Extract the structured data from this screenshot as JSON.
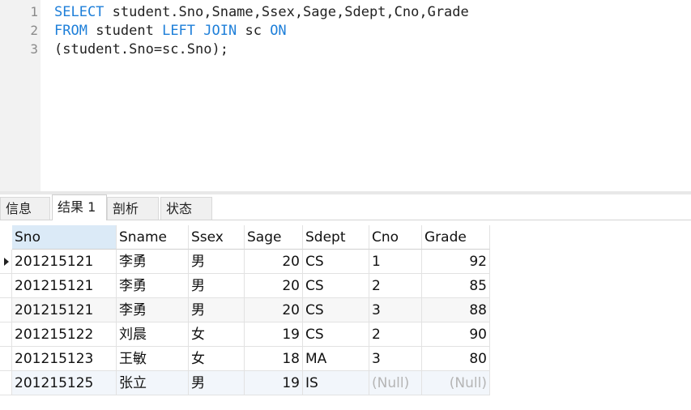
{
  "editor": {
    "lines": [
      {
        "number": "1",
        "tokens": [
          {
            "text": "SELECT",
            "kind": "kw"
          },
          {
            "text": " student.Sno,Sname,Ssex,Sage,Sdept,Cno,Grade",
            "kind": "plain"
          }
        ]
      },
      {
        "number": "2",
        "tokens": [
          {
            "text": "FROM",
            "kind": "kw"
          },
          {
            "text": " student ",
            "kind": "plain"
          },
          {
            "text": "LEFT",
            "kind": "kw"
          },
          {
            "text": " ",
            "kind": "plain"
          },
          {
            "text": "JOIN",
            "kind": "kw"
          },
          {
            "text": " sc ",
            "kind": "plain"
          },
          {
            "text": "ON",
            "kind": "kw"
          }
        ]
      },
      {
        "number": "3",
        "tokens": [
          {
            "text": "(student.Sno=sc.Sno);",
            "kind": "plain"
          }
        ]
      }
    ]
  },
  "tabs": [
    {
      "label": "信息",
      "active": false
    },
    {
      "label": "结果 1",
      "active": true
    },
    {
      "label": "剖析",
      "active": false
    },
    {
      "label": "状态",
      "active": false
    }
  ],
  "grid": {
    "columns": [
      "Sno",
      "Sname",
      "Ssex",
      "Sage",
      "Sdept",
      "Cno",
      "Grade"
    ],
    "sorted_column": "Sno",
    "rows": [
      [
        "201215121",
        "李勇",
        "男",
        "20",
        "CS",
        "1",
        "92"
      ],
      [
        "201215121",
        "李勇",
        "男",
        "20",
        "CS",
        "2",
        "85"
      ],
      [
        "201215121",
        "李勇",
        "男",
        "20",
        "CS",
        "3",
        "88"
      ],
      [
        "201215122",
        "刘晨",
        "女",
        "19",
        "CS",
        "2",
        "90"
      ],
      [
        "201215123",
        "王敏",
        "女",
        "18",
        "MA",
        "3",
        "80"
      ],
      [
        "201215125",
        "张立",
        "男",
        "19",
        "IS",
        "(Null)",
        "(Null)"
      ]
    ],
    "current_row": 1,
    "null_text": "(Null)"
  },
  "colors": {
    "keyword": "#1e7fd9",
    "null": "#b5b5b5",
    "header_sorted": "#dbeaf7"
  }
}
